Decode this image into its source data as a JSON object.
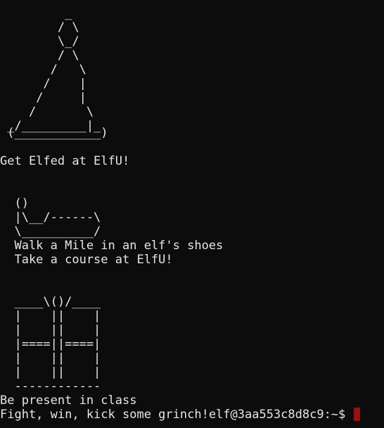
{
  "terminal": {
    "hat_art": [
      "         _",
      "        / \\",
      "        \\_/",
      "        / \\",
      "       /   \\",
      "      /    |",
      "     /     |",
      "    /       \\",
      " _/_________|_",
      " (____________)"
    ],
    "line_get_elfed": "Get Elfed at ElfU!",
    "shoe_art": [
      "  ()",
      "  |\\__/------\\",
      "  \\__________/"
    ],
    "line_walk_mile": "  Walk a Mile in an elf's shoes",
    "line_take_course": "  Take a course at ElfU!",
    "gift_art": [
      "  ____\\()/____",
      "  |    ||    |",
      "  |    ||    |",
      "  |====||====|",
      "  |    ||    |",
      "  |    ||    |",
      "  ------------"
    ],
    "line_be_present": "Be present in class",
    "line_fight": "Fight, win, kick some grinch!",
    "prompt": "elf@3aa553c8d8c9:~$ ",
    "colors": {
      "background": "#0c0c0c",
      "foreground": "#e6e6e6",
      "cursor": "#9a1111"
    }
  }
}
